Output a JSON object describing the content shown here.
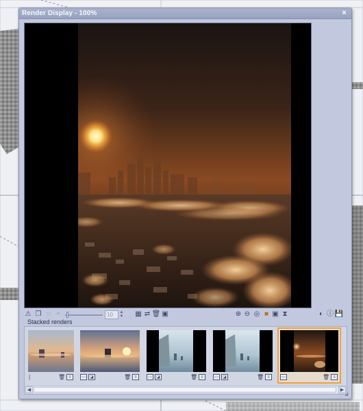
{
  "window": {
    "title": "Render Display - 100%",
    "close_symbol": "×"
  },
  "toolbar": {
    "zoom_value": "10"
  },
  "stacked_renders": {
    "label": "Stacked renders",
    "thumbnails": [
      {
        "scene": "sunrise-sea-rocks",
        "selected": false,
        "index_marker": "|"
      },
      {
        "scene": "sunset-sea-rocks",
        "selected": false
      },
      {
        "scene": "sea-stacks-daylight",
        "selected": false
      },
      {
        "scene": "sea-stacks-daylight",
        "selected": false
      },
      {
        "scene": "city-sunset-clouds",
        "selected": true
      }
    ]
  },
  "colors": {
    "window_frame": "#c2c9de",
    "title_bar": "#98a2bf",
    "selection_accent": "#f0a040"
  },
  "icons": {
    "toolbar_left": [
      "warning-icon",
      "copy-icon",
      "dim-star-icon",
      "dim-stars-icon"
    ],
    "toolbar_mid": [
      "stack-add-icon",
      "compare-icon",
      "delete-icon",
      "export-icon"
    ],
    "toolbar_right": [
      "zoom-in-icon",
      "zoom-out-icon",
      "fit-icon",
      "color-channels-icon",
      "alpha-icon",
      "hourglass-icon",
      "contrast-icon",
      "info-icon",
      "save-icon"
    ]
  }
}
